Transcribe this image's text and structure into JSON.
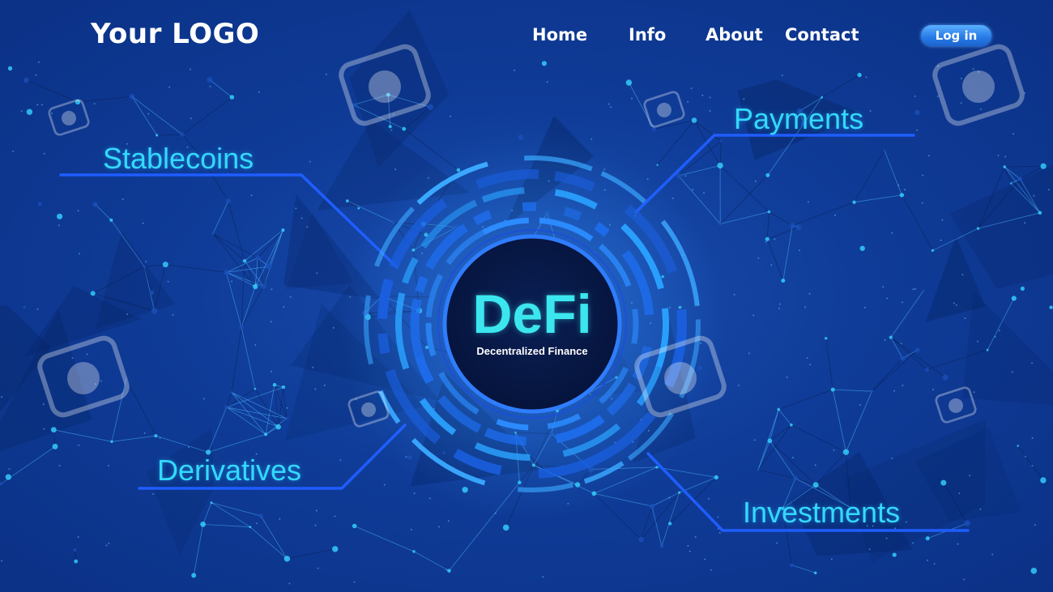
{
  "header": {
    "logo_text": "Your LOGO",
    "nav": [
      {
        "label": "Home"
      },
      {
        "label": "Info"
      },
      {
        "label": "About"
      },
      {
        "label": "Contact"
      }
    ],
    "login_label": "Log in"
  },
  "hero": {
    "title": "DeFi",
    "subtitle": "Decentralized Finance",
    "features": [
      {
        "label": "Stablecoins"
      },
      {
        "label": "Payments"
      },
      {
        "label": "Derivatives"
      },
      {
        "label": "Investments"
      }
    ]
  },
  "colors": {
    "background": "#0f3c98",
    "accent_cyan": "#34d9ff",
    "line_blue": "#1f5dff",
    "button_blue": "#2a7de8"
  },
  "watermark_icons": [
    "camera-watermark-icon"
  ]
}
